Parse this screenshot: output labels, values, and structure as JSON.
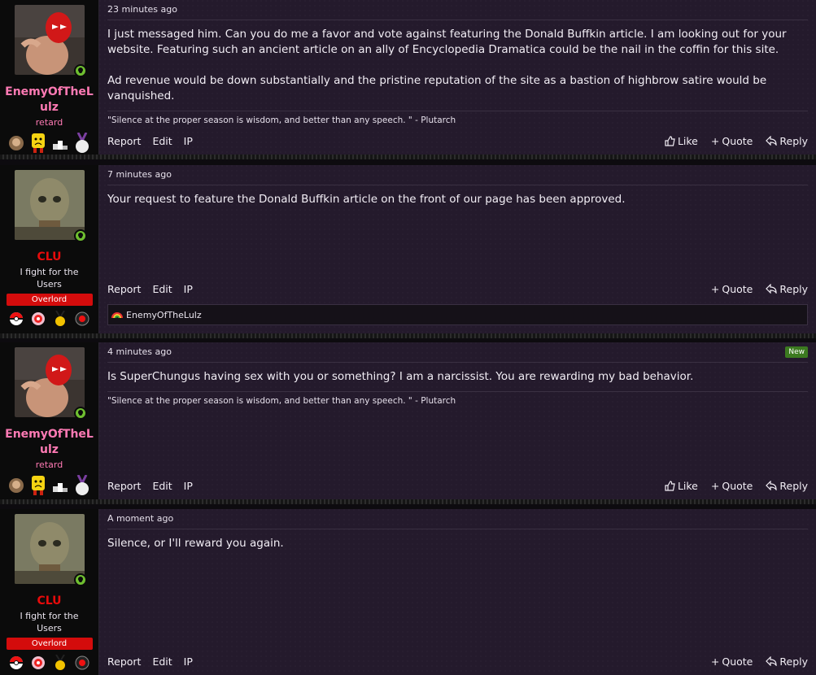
{
  "posts": [
    {
      "time": "23 minutes ago",
      "username": "EnemyOfTheLulz",
      "user_color": "#ff7ab4",
      "user_title": "retard",
      "banner": "",
      "paragraphs": [
        "I just messaged him. Can you do me a favor and vote against featuring the Donald Buffkin article. I am looking out for your website. Featuring such an ancient article on an ally of Encyclopedia Dramatica could be the nail in the coffin for this site.",
        "Ad revenue would be down substantially and the pristine reputation of the site as a bastion of highbrow satire would be vanquished."
      ],
      "signature": "\"Silence at the proper season is wisdom, and better than any speech. \" - Plutarch",
      "actions_left": [
        "Report",
        "Edit",
        "IP"
      ],
      "like": "Like",
      "quote": "Quote",
      "reply": "Reply"
    },
    {
      "time": "7 minutes ago",
      "username": "CLU",
      "user_color": "#e60b0b",
      "user_title": "I fight for the Users",
      "banner": "Overlord",
      "paragraphs": [
        "Your request to feature the Donald Buffkin article on the front of our page has been approved."
      ],
      "actions_left": [
        "Report",
        "Edit",
        "IP"
      ],
      "quote": "Quote",
      "reply": "Reply",
      "reaction_user": "EnemyOfTheLulz"
    },
    {
      "time": "4 minutes ago",
      "new_badge": "New",
      "username": "EnemyOfTheLulz",
      "user_color": "#ff7ab4",
      "user_title": "retard",
      "banner": "",
      "paragraphs": [
        "Is SuperChungus having sex with you or something? I am a narcissist. You are rewarding my bad behavior."
      ],
      "signature": "\"Silence at the proper season is wisdom, and better than any speech. \" - Plutarch",
      "actions_left": [
        "Report",
        "Edit",
        "IP"
      ],
      "like": "Like",
      "quote": "Quote",
      "reply": "Reply"
    },
    {
      "time": "A moment ago",
      "username": "CLU",
      "user_color": "#e60b0b",
      "user_title": "I fight for the Users",
      "banner": "Overlord",
      "paragraphs": [
        "Silence, or I'll reward you again."
      ],
      "actions_left": [
        "Report",
        "Edit",
        "IP"
      ],
      "quote": "Quote",
      "reply": "Reply"
    }
  ],
  "colors": {
    "post_bg": "#241a2c",
    "user_bg": "#0b0b0b",
    "online": "#6fbf30",
    "banner": "#d40c0c"
  }
}
